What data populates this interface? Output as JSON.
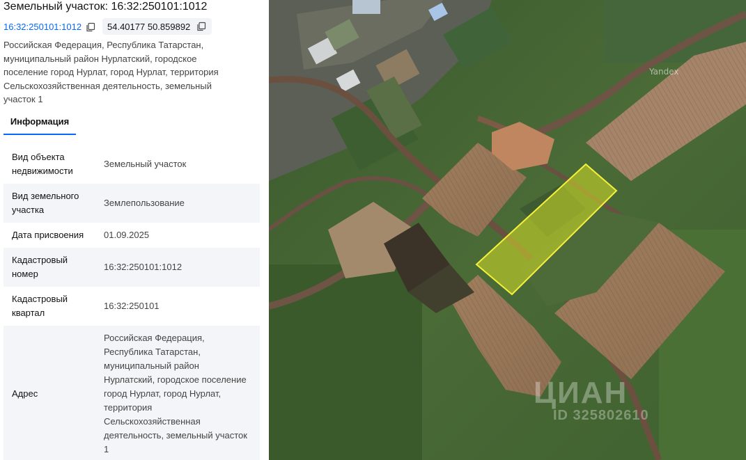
{
  "header": {
    "title": "Земельный участок: 16:32:250101:1012",
    "cadastral_link": "16:32:250101:1012",
    "coordinates": "54.40177 50.859892",
    "address": "Российская Федерация, Республика Татарстан, муниципальный район Нурлатский, городское поселение город Нурлат, город Нурлат, территория Сельскохозяйственная деятельность, земельный участок 1"
  },
  "tabs": [
    {
      "label": "Информация",
      "active": true
    }
  ],
  "info_rows": [
    {
      "label": "Вид объекта недвижимости",
      "value": "Земельный участок"
    },
    {
      "label": "Вид земельного участка",
      "value": "Землепользование"
    },
    {
      "label": "Дата присвоения",
      "value": "01.09.2025"
    },
    {
      "label": "Кадастровый номер",
      "value": "16:32:250101:1012"
    },
    {
      "label": "Кадастровый квартал",
      "value": "16:32:250101"
    },
    {
      "label": "Адрес",
      "value": "Российская Федерация, Республика Татарстан, муниципальный район Нурлатский, городское поселение город Нурлат, город Нурлат, территория Сельскохозяйственная деятельность, земельный участок 1"
    }
  ],
  "map": {
    "provider_watermark": "Yandex",
    "brand_watermark": "ЦИАН",
    "listing_id_watermark": "ID 325802610",
    "parcel_outline_color": "#f5f03a"
  },
  "icons": {
    "copy": "copy-icon"
  },
  "colors": {
    "link": "#0468ff",
    "tab_underline": "#0468ff",
    "row_alt_bg": "#f4f5f8",
    "chip_bg": "#f2f3f7"
  }
}
